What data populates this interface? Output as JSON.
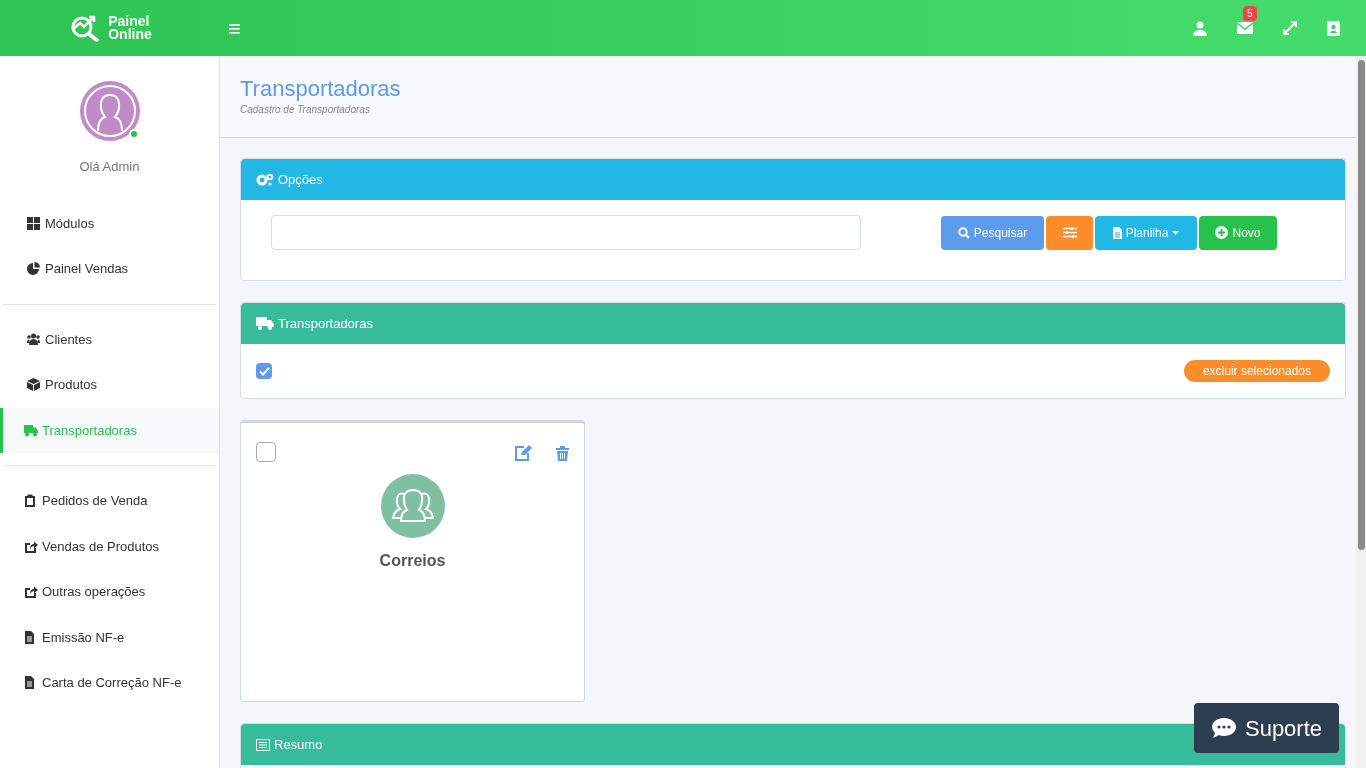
{
  "header": {
    "logo_line1": "Painel",
    "logo_line2": "Online",
    "menu_glyph": "≡",
    "mail_badge": "5"
  },
  "sidebar": {
    "greeting": "Olá Admin",
    "user_online": true,
    "groups": [
      [
        {
          "label": "Módulos",
          "selected": false
        },
        {
          "label": "Painel Vendas",
          "selected": false
        }
      ],
      [
        {
          "label": "Clientes",
          "selected": false
        },
        {
          "label": "Produtos",
          "selected": false
        },
        {
          "label": "Transportadoras",
          "selected": true
        }
      ],
      [
        {
          "label": "Pedidos de Venda",
          "selected": false
        },
        {
          "label": "Vendas de Produtos",
          "selected": false
        },
        {
          "label": "Outras operações",
          "selected": false
        },
        {
          "label": "Emissão NF-e",
          "selected": false
        },
        {
          "label": "Carta de Correção NF-e",
          "selected": false
        }
      ]
    ]
  },
  "page": {
    "title": "Transportadoras",
    "subtitle": "Cadastro de Transportadoras"
  },
  "options_panel": {
    "title": "Opções",
    "buttons": [
      {
        "kind": "search",
        "label": "Pesquisar"
      },
      {
        "kind": "filter"
      },
      {
        "kind": "sheet",
        "label": "Planilha"
      },
      {
        "kind": "new",
        "label": "Novo"
      }
    ]
  },
  "list_panel": {
    "title": "Transportadoras",
    "select_all_checked": true,
    "delete_button": "excluir selecionados"
  },
  "cards": [
    {
      "name": "Correios",
      "checked": false
    }
  ],
  "summary_panel": {
    "title": "Resumo"
  },
  "support_button": "Suporte"
}
